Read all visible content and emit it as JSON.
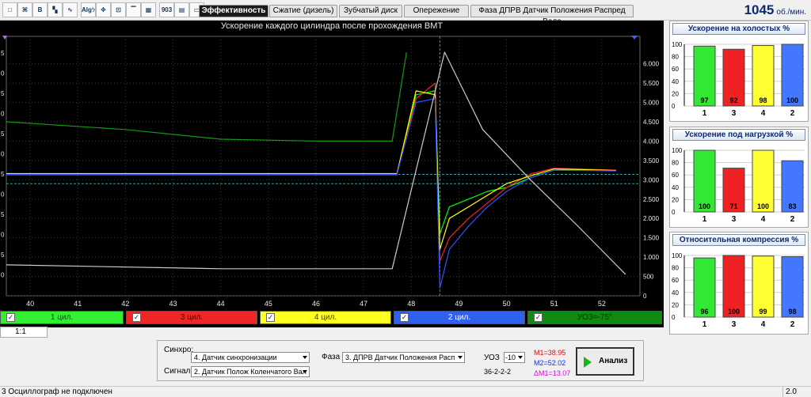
{
  "toolbar": {
    "icons": [
      "icon-1",
      "icon-2",
      "icon-3",
      "icon-4",
      "icon-5",
      "icon-6",
      "icon-7",
      "icon-8",
      "icon-9",
      "icon-10",
      "icon-11",
      "icon-12",
      "icon-13"
    ],
    "icon_glyphs": [
      "□",
      "⌘",
      "B",
      "▚",
      "∿",
      "Alg½",
      "✥",
      "⊡",
      "▔",
      "▦",
      "903",
      "▤",
      "▭"
    ]
  },
  "tabs": [
    {
      "label": "Эффективность",
      "active": true
    },
    {
      "label": "Сжатие (дизель)",
      "active": false
    },
    {
      "label": "Зубчатый диск",
      "active": false
    },
    {
      "label": "Опережение",
      "active": false
    },
    {
      "label": "Фаза ДПРВ Датчик Положения Распред Вала",
      "active": false
    }
  ],
  "rpm": {
    "value": "1045",
    "unit": "об./мин."
  },
  "chart": {
    "title": "Ускорение каждого цилиндра после прохождения ВМТ",
    "x_ticks": [
      "40",
      "41",
      "42",
      "43",
      "44",
      "45",
      "46",
      "47",
      "48",
      "49",
      "50",
      "51",
      "52"
    ],
    "right_ticks": [
      "6.000",
      "5.500",
      "5.000",
      "4.500",
      "4.000",
      "3.500",
      "3.000",
      "2.500",
      "2.000",
      "1.500",
      "1.000",
      "500",
      "0"
    ],
    "left_ticks": [
      "5",
      "0",
      "5",
      "0",
      "5",
      "0",
      "5",
      "0",
      "5",
      "0",
      "5",
      "0"
    ]
  },
  "chart_data": {
    "type": "line",
    "title": "Ускорение каждого цилиндра после прохождения ВМТ",
    "x_range": [
      39.5,
      52.8
    ],
    "y_right_range": [
      0,
      6300
    ],
    "series": [
      {
        "name": "1 цил.",
        "color": "#00ff00",
        "points": [
          [
            39.5,
            3150
          ],
          [
            47.7,
            3150
          ],
          [
            48.1,
            5200
          ],
          [
            48.5,
            5300
          ],
          [
            48.6,
            1600
          ],
          [
            48.8,
            2300
          ],
          [
            49.2,
            2500
          ],
          [
            49.6,
            2700
          ],
          [
            50.0,
            2800
          ],
          [
            50.5,
            3050
          ],
          [
            51.0,
            3250
          ],
          [
            52.3,
            3250
          ]
        ]
      },
      {
        "name": "3 цил.",
        "color": "#ff2020",
        "points": [
          [
            39.5,
            3130
          ],
          [
            47.7,
            3130
          ],
          [
            48.1,
            5100
          ],
          [
            48.5,
            5500
          ],
          [
            48.6,
            900
          ],
          [
            48.8,
            1500
          ],
          [
            49.2,
            2000
          ],
          [
            49.6,
            2400
          ],
          [
            50.0,
            2800
          ],
          [
            50.5,
            3150
          ],
          [
            51.0,
            3300
          ],
          [
            52.3,
            3250
          ]
        ]
      },
      {
        "name": "4 цил.",
        "color": "#ffff00",
        "points": [
          [
            39.5,
            3160
          ],
          [
            47.7,
            3160
          ],
          [
            48.1,
            5300
          ],
          [
            48.5,
            5200
          ],
          [
            48.6,
            1200
          ],
          [
            48.8,
            2000
          ],
          [
            49.2,
            2300
          ],
          [
            49.6,
            2600
          ],
          [
            50.0,
            2900
          ],
          [
            50.5,
            3100
          ],
          [
            51.0,
            3280
          ],
          [
            52.3,
            3240
          ]
        ]
      },
      {
        "name": "2 цил.",
        "color": "#3050ff",
        "points": [
          [
            39.5,
            3140
          ],
          [
            47.7,
            3140
          ],
          [
            48.1,
            5000
          ],
          [
            48.5,
            5100
          ],
          [
            48.6,
            200
          ],
          [
            48.8,
            1200
          ],
          [
            49.2,
            1800
          ],
          [
            49.6,
            2300
          ],
          [
            50.0,
            2700
          ],
          [
            50.5,
            3050
          ],
          [
            51.0,
            3250
          ],
          [
            52.3,
            3230
          ]
        ]
      },
      {
        "name": "УОЗ=-75°",
        "color": "#139a13",
        "points": [
          [
            39.5,
            4500
          ],
          [
            42.0,
            4300
          ],
          [
            44.0,
            4050
          ],
          [
            46.0,
            4000
          ],
          [
            47.6,
            4000
          ],
          [
            47.9,
            6300
          ]
        ]
      },
      {
        "name": "",
        "color": "#cccccc",
        "points": [
          [
            39.5,
            800
          ],
          [
            44.0,
            700
          ],
          [
            47.6,
            700
          ],
          [
            48.7,
            6300
          ],
          [
            49.5,
            4300
          ],
          [
            50.5,
            3000
          ],
          [
            51.5,
            1800
          ],
          [
            52.5,
            550
          ]
        ]
      }
    ],
    "h_lines": [
      2900,
      3140
    ],
    "v_line": 48.6
  },
  "legend": [
    {
      "label": "1 цил.",
      "color": "#33ee33",
      "text": "#115511"
    },
    {
      "label": "3 цил.",
      "color": "#ee2626",
      "text": "#550000"
    },
    {
      "label": "4 цил.",
      "color": "#ffff22",
      "text": "#444400"
    },
    {
      "label": "2 цил.",
      "color": "#3060ee",
      "text": "#ffffff"
    },
    {
      "label": "УОЗ=-75°",
      "color": "#108a10",
      "text": "#003300"
    }
  ],
  "scale_label": "1:1",
  "panels": [
    {
      "title": "Ускорение на холостых %",
      "ticks": [
        "100",
        "80",
        "60",
        "40",
        "20",
        "0"
      ],
      "bars": [
        {
          "cyl": "1",
          "value": 97,
          "color": "#33e833"
        },
        {
          "cyl": "3",
          "value": 92,
          "color": "#ee2222"
        },
        {
          "cyl": "4",
          "value": 98,
          "color": "#ffff33"
        },
        {
          "cyl": "2",
          "value": 100,
          "color": "#4477ff"
        }
      ]
    },
    {
      "title": "Ускорение под нагрузкой %",
      "ticks": [
        "100",
        "80",
        "60",
        "40",
        "20",
        "0"
      ],
      "bars": [
        {
          "cyl": "1",
          "value": 100,
          "color": "#33e833"
        },
        {
          "cyl": "3",
          "value": 71,
          "color": "#ee2222"
        },
        {
          "cyl": "4",
          "value": 100,
          "color": "#ffff33"
        },
        {
          "cyl": "2",
          "value": 83,
          "color": "#4477ff"
        }
      ]
    },
    {
      "title": "Относительная компрессия %",
      "ticks": [
        "100",
        "80",
        "60",
        "40",
        "20",
        "0"
      ],
      "bars": [
        {
          "cyl": "1",
          "value": 96,
          "color": "#33e833"
        },
        {
          "cyl": "3",
          "value": 100,
          "color": "#ee2222"
        },
        {
          "cyl": "4",
          "value": 99,
          "color": "#ffff33"
        },
        {
          "cyl": "2",
          "value": 98,
          "color": "#4477ff"
        }
      ]
    }
  ],
  "controls": {
    "sync_label": "Синхро:",
    "sync_value": "4. Датчик синхронизации",
    "signal_label": "Сигнал:",
    "signal_value": "2. Датчик Полож Коленчатого Вал",
    "phase_label": "Фаза",
    "phase_value": "3. ДПРВ Датчик Положения Расп",
    "uoz_label": "УОЗ",
    "uoz_value": "-10",
    "code": "36-2-2-2",
    "m1": "M1=38.95",
    "m2": "M2=52.02",
    "dm": "ΔM1=13.07",
    "analyze_label": "Анализ"
  },
  "status": {
    "left": "3 Осциллограф не подключен",
    "right": "2.0"
  }
}
